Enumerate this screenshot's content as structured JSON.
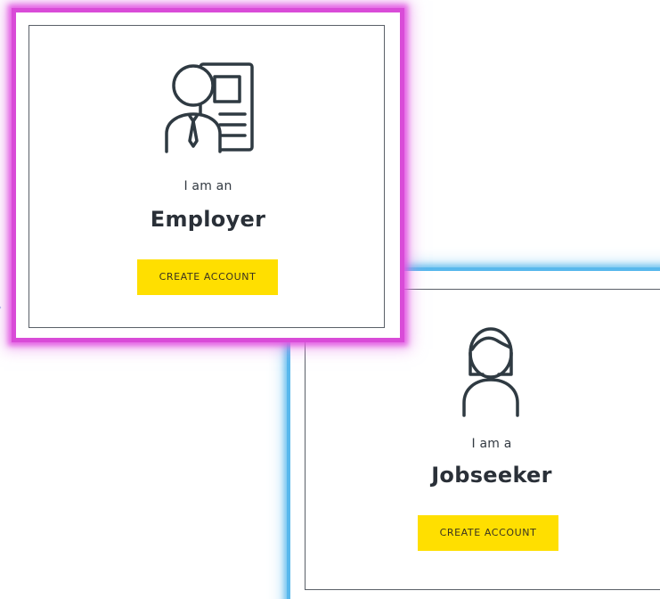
{
  "colors": {
    "employer_glow": "#d94bd8",
    "jobseeker_glow": "#58b8ec",
    "button_bg": "#ffdf00",
    "text_dark": "#2a3038",
    "icon_stroke": "#2f3a42"
  },
  "employer_card": {
    "icon": "employer-badge-icon",
    "subtitle": "I am an",
    "title": "Employer",
    "button_label": "CREATE ACCOUNT"
  },
  "jobseeker_card": {
    "icon": "jobseeker-person-icon",
    "subtitle": "I am a",
    "title": "Jobseeker",
    "button_label": "CREATE ACCOUNT"
  }
}
